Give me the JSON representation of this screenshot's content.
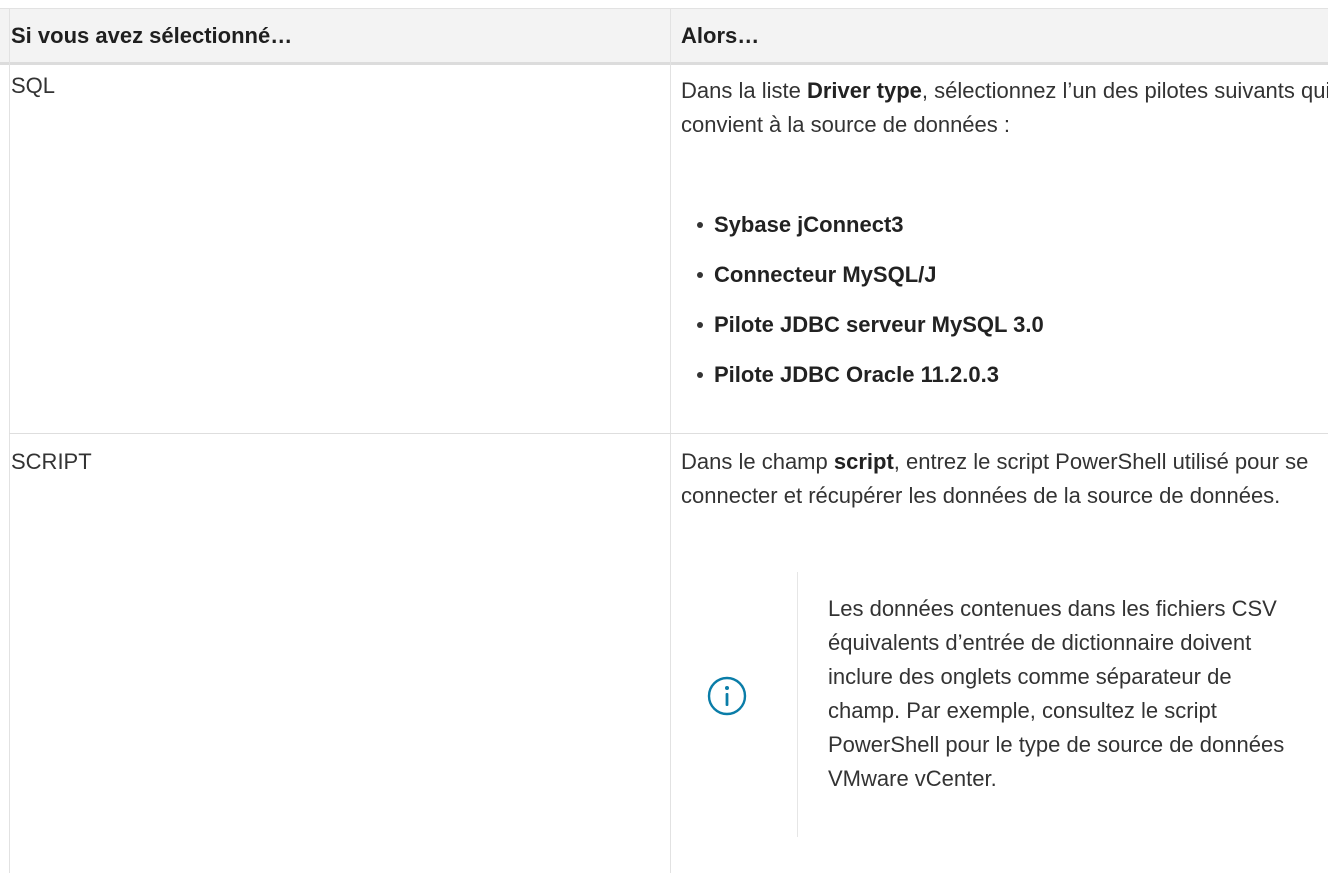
{
  "table": {
    "headers": [
      "Si vous avez sélectionné…",
      "Alors…"
    ],
    "rows": [
      {
        "selection": "SQL",
        "action": {
          "intro_before": "Dans la liste ",
          "intro_bold": "Driver type",
          "intro_after": ", sélectionnez l’un des pilotes suivants qui convient à la source de données :",
          "drivers": [
            "Sybase jConnect3",
            "Connecteur MySQL/J",
            "Pilote JDBC serveur MySQL 3.0",
            "Pilote JDBC Oracle 11.2.0.3"
          ]
        }
      },
      {
        "selection": "SCRIPT",
        "action": {
          "intro_before": "Dans le champ ",
          "intro_bold": "script",
          "intro_after": ", entrez le script PowerShell utilisé pour se connecter et récupérer les données de la source de données.",
          "note": {
            "icon": "info-icon",
            "text": "Les données contenues dans les fichiers CSV équivalents d’entrée de dictionnaire doivent inclure des onglets comme séparateur de champ. Par exemple, consultez le script PowerShell pour le type de source de données VMware vCenter."
          }
        }
      }
    ]
  },
  "colors": {
    "header_bg": "#f3f3f3",
    "border": "#e2e2e2",
    "text": "#333333",
    "info_icon": "#0a7da8"
  }
}
